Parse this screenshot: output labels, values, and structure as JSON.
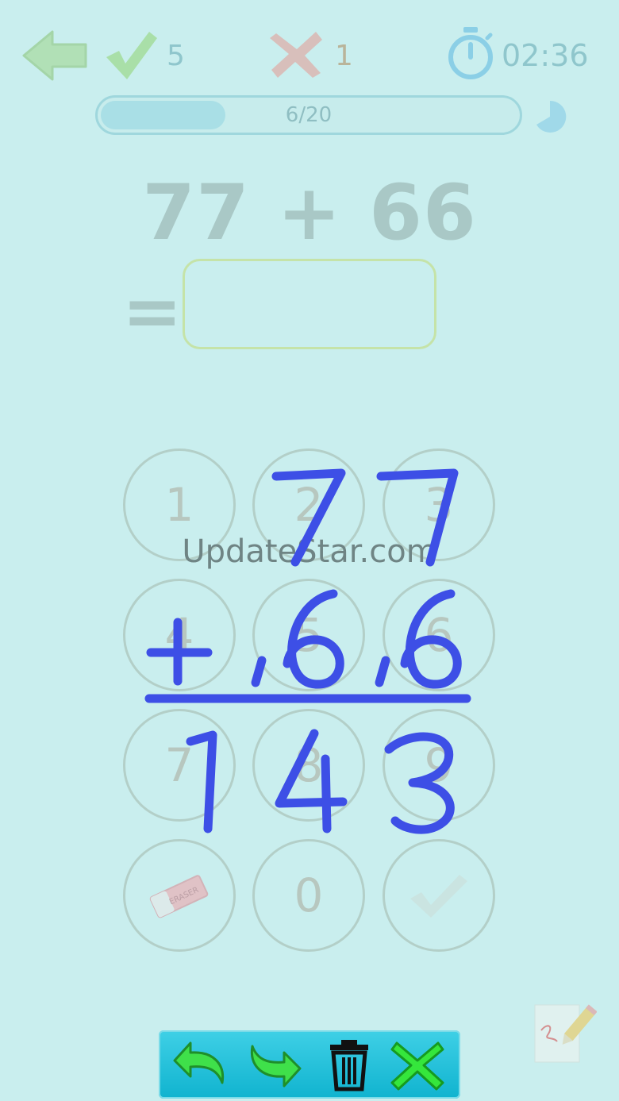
{
  "score": {
    "correct": "5",
    "wrong": "1",
    "timer": "02:36"
  },
  "progress": {
    "label": "6/20",
    "fraction": 0.3
  },
  "question": {
    "expression": "77 + 66",
    "equals": "=",
    "answer": ""
  },
  "keypad": {
    "digits": [
      "1",
      "2",
      "3",
      "4",
      "5",
      "6",
      "7",
      "8",
      "9",
      "0"
    ],
    "eraser_text": "ERASER"
  },
  "watermark": "UpdateStar.com",
  "colors": {
    "background": "#c9eeee",
    "ink": "#3d4fe6",
    "check_green": "#7ad85a",
    "toolbar": "#1fc1da"
  },
  "icons": [
    "back-arrow-icon",
    "check-icon",
    "cross-icon",
    "stopwatch-icon",
    "pie-icon",
    "eraser-icon",
    "checkmark-icon",
    "notepad-pencil-icon",
    "undo-icon",
    "redo-icon",
    "trash-icon",
    "close-icon"
  ]
}
